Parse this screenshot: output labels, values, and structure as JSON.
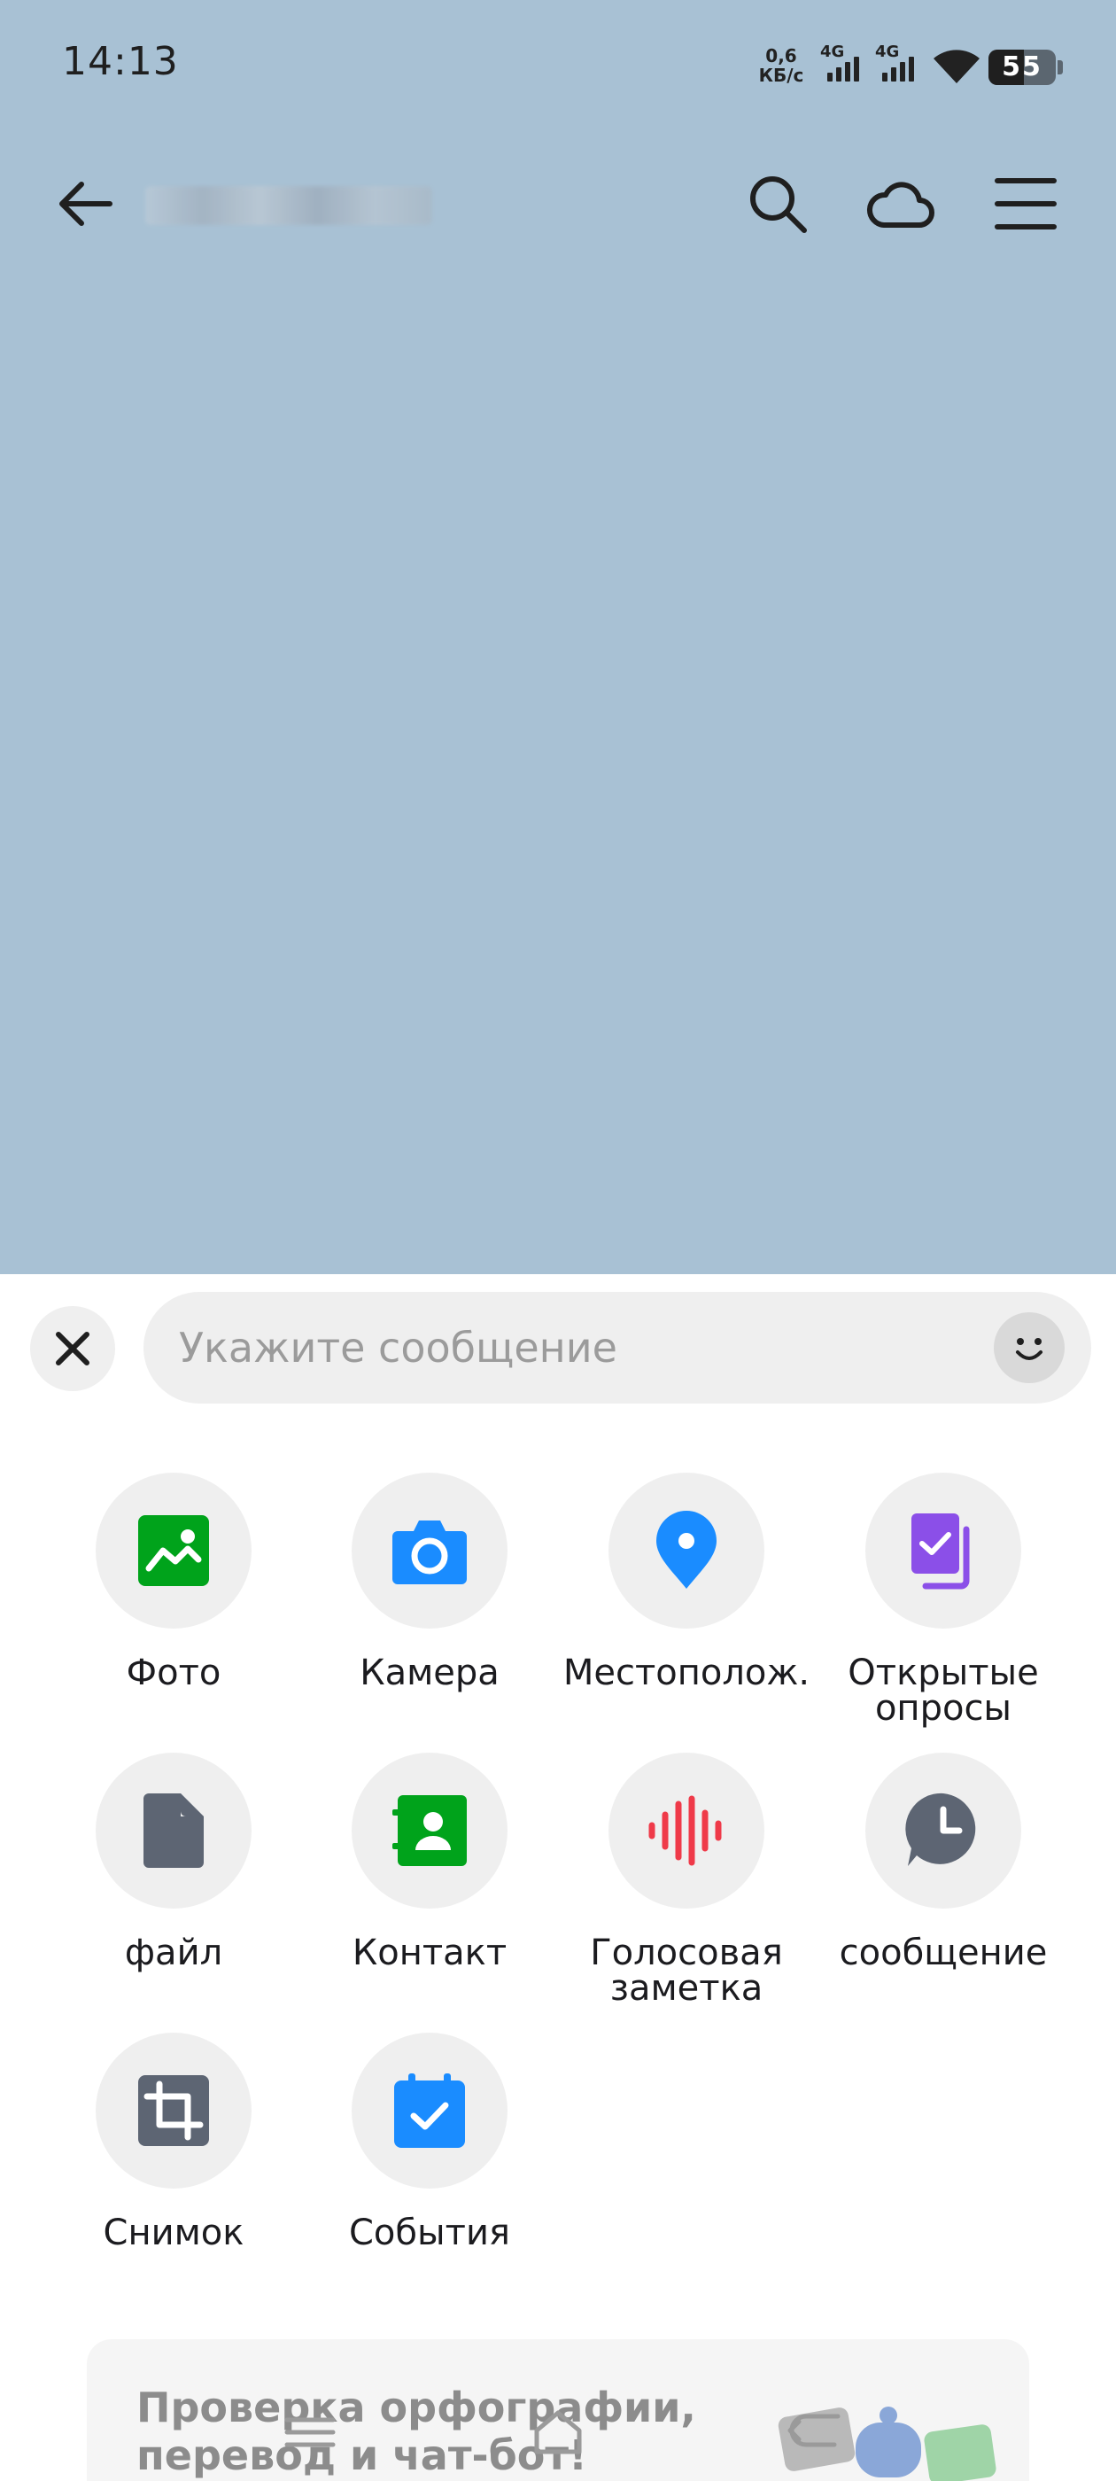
{
  "status_bar": {
    "time": "14:13",
    "net_speed_value": "0,6",
    "net_speed_unit": "КБ/с",
    "sim1_label": "4G",
    "sim2_label": "4G",
    "battery": "55"
  },
  "header": {
    "back_icon": "arrow-left-icon",
    "search_icon": "search-icon",
    "cloud_icon": "cloud-icon",
    "menu_icon": "menu-icon"
  },
  "composer": {
    "placeholder": "Укажите сообщение",
    "close_icon": "close-icon",
    "emoji_icon": "smiley-icon"
  },
  "attachments": [
    {
      "label": "Фото",
      "icon": "photo-icon",
      "color": "#00a31b"
    },
    {
      "label": "Камера",
      "icon": "camera-icon",
      "color": "#1a8cff"
    },
    {
      "label": "Местополож.",
      "icon": "location-pin-icon",
      "color": "#1a8cff"
    },
    {
      "label": "Открытые\nопросы",
      "icon": "poll-icon",
      "color": "#8b4fe8"
    },
    {
      "label": "файл",
      "icon": "file-icon",
      "color": "#5d6573"
    },
    {
      "label": "Контакт",
      "icon": "contact-icon",
      "color": "#00a31b"
    },
    {
      "label": "Голосовая\nзаметка",
      "icon": "voice-note-icon",
      "color": "#ef3a49"
    },
    {
      "label": "сообщение",
      "icon": "scheduled-message-icon",
      "color": "#5d6573"
    },
    {
      "label": "Снимок",
      "icon": "crop-icon",
      "color": "#5d6573"
    },
    {
      "label": "События",
      "icon": "calendar-check-icon",
      "color": "#1a8cff"
    }
  ],
  "promo": {
    "text": "Проверка орфографии,\nперевод и чат-бот!"
  },
  "nav": {
    "recents_icon": "recents-icon",
    "home_icon": "home-icon",
    "back_icon": "back-icon"
  }
}
